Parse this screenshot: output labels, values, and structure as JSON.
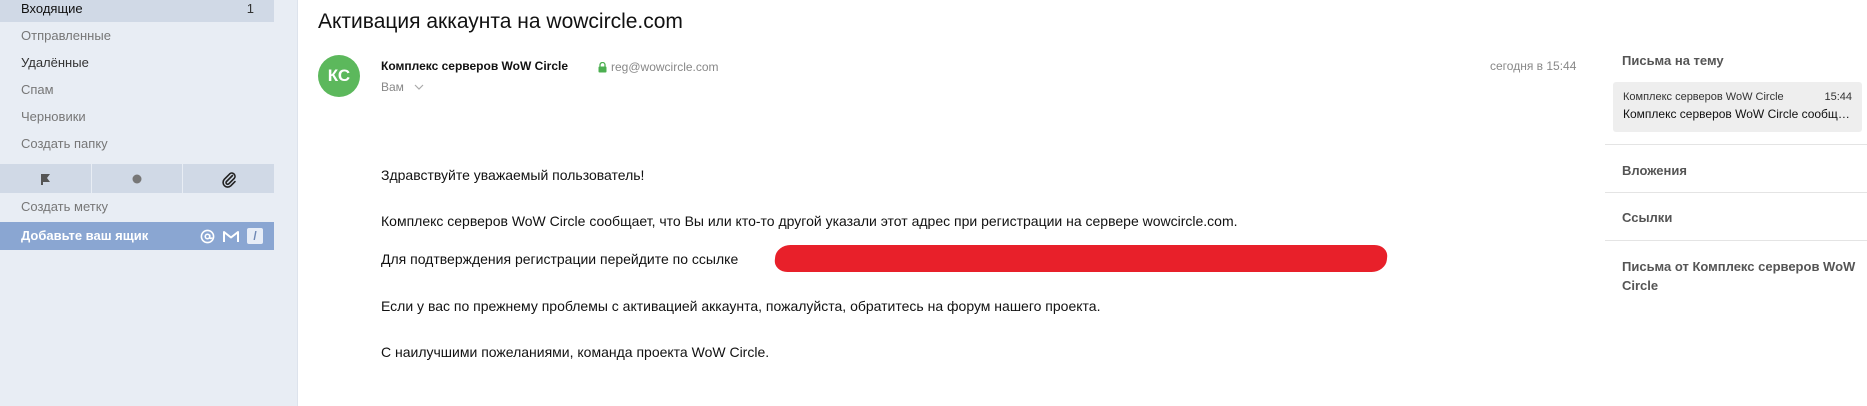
{
  "sidebar": {
    "folders": [
      {
        "label": "Входящие",
        "count": "1"
      },
      {
        "label": "Отправленные"
      },
      {
        "label": "Удалённые"
      },
      {
        "label": "Спам"
      },
      {
        "label": "Черновики"
      },
      {
        "label": "Создать папку"
      }
    ],
    "create_label": "Создать метку",
    "add_mailbox": "Добавьте ваш ящик"
  },
  "message": {
    "subject": "Активация аккаунта на wowcircle.com",
    "avatar_initials": "КС",
    "avatar_color": "#5cb85c",
    "sender_name": "Комплекс серверов WoW Circle",
    "sender_email": "reg@wowcircle.com",
    "recipient": "Вам",
    "date": "сегодня в 15:44",
    "body": [
      "Здравствуйте уважаемый пользователь!",
      "Комплекс серверов WoW Circle сообщает, что Вы или кто-то другой указали этот адрес при регистрации на сервере wowcircle.com.",
      "Для подтверждения регистрации перейдите по ссылке",
      "Если у вас по прежнему проблемы с активацией аккаунта, пожалуйста, обратитесь на форум нашего проекта.",
      "С наилучшими пожеланиями, команда проекта WoW Circle."
    ],
    "redaction_color": "#e8202a"
  },
  "right_panel": {
    "thread_title": "Письма на тему",
    "thread_item": {
      "from": "Комплекс серверов WoW Circle",
      "time": "15:44",
      "subject": "Комплекс серверов WoW Circle сообщает"
    },
    "attachments": "Вложения",
    "links": "Ссылки",
    "from_sender": "Письма от Комплекс серверов WoW Circle"
  }
}
